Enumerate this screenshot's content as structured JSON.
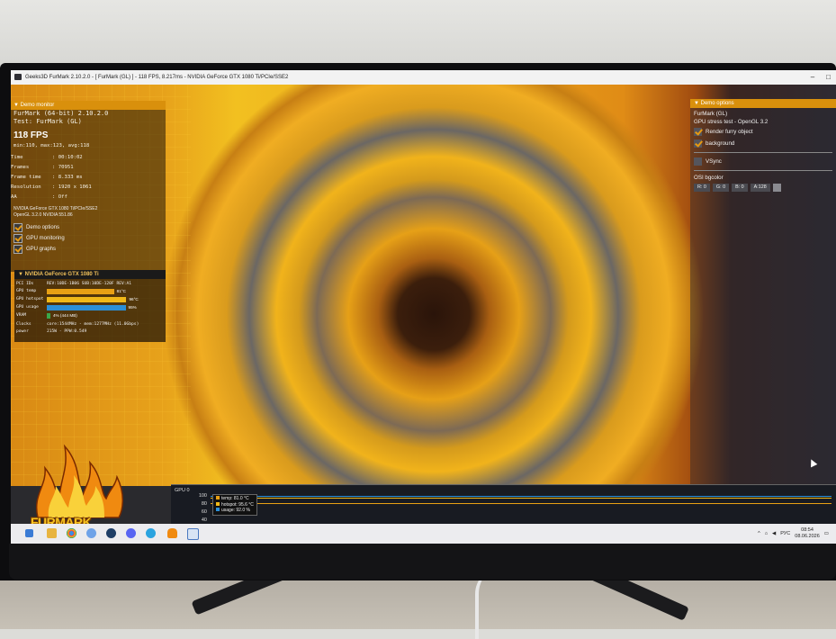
{
  "window": {
    "title": "Geeks3D FurMark 2.10.2.0 - [ FurMark (GL) ] - 118 FPS, 8.217ms - NVIDIA GeForce GTX 1080 Ti/PCIe/SSE2",
    "minimize": "–",
    "maximize": "□"
  },
  "demo_monitor": {
    "header": "Demo monitor",
    "app_line": "FurMark (64-bit) 2.10.2.0",
    "test_line": "Test: FurMark (GL)",
    "fps": "118 FPS",
    "fps_stats": "min:110, max:123, avg:118",
    "stats": [
      {
        "label": "Time",
        "value": ": 00:10:02"
      },
      {
        "label": "Frames",
        "value": ": 70951"
      },
      {
        "label": "Frame time",
        "value": ": 8.333 ms"
      },
      {
        "label": "Resolution",
        "value": ": 1920 x 1061"
      },
      {
        "label": "AA",
        "value": ": Off"
      }
    ],
    "gpu_line": "NVIDIA GeForce GTX 1080 Ti/PCIe/SSE2",
    "gl_line": "OpenGL 3.2.0 NVIDIA 551.86",
    "checkboxes": [
      {
        "label": "Demo options",
        "checked": true
      },
      {
        "label": "GPU monitoring",
        "checked": true
      },
      {
        "label": "GPU graphs",
        "checked": true
      }
    ]
  },
  "gpu_panel": {
    "header": "NVIDIA GeForce GTX 1080 Ti",
    "pci_label": "PCI IDs",
    "pci_value": "REV:10DE-1B06 SUB:10DE-120F REV:A1",
    "rows": [
      {
        "label": "GPU temp",
        "value": "81°C",
        "level": 0.81,
        "color": "#e8a014"
      },
      {
        "label": "GPU hotspot",
        "value": "96°C",
        "level": 0.96,
        "color": "#f0b818"
      },
      {
        "label": "GPU usage",
        "value": "95%",
        "level": 0.95,
        "color": "#2a8fd8"
      },
      {
        "label": "VRAM",
        "value": "4% (444 MB)",
        "level": 0.04,
        "color": "#3aa84a"
      }
    ],
    "clocks_label": "Clocks",
    "clocks_value": "core:1544MHz - mem:1277MHz (11.0Gbps)",
    "power_label": "power",
    "power_value": "215W - PPW:0.549"
  },
  "logo_text": "FURMARK",
  "demo_options": {
    "header": "Demo options",
    "name": "FurMark (GL)",
    "desc": "GPU stress test - OpenGL 3.2",
    "checkboxes": [
      {
        "label": "Render furry object",
        "checked": true
      },
      {
        "label": "background",
        "checked": true
      }
    ],
    "vsync": {
      "label": "VSync",
      "checked": false
    },
    "osi_label": "OSI bgcolor",
    "color_fields": [
      "R: 0",
      "G: 0",
      "B: 0",
      "A:128"
    ]
  },
  "graph": {
    "label": "GPU 0",
    "ticks": [
      "100",
      "80",
      "60",
      "40"
    ],
    "legend": [
      {
        "label": "temp: 81.0 °C",
        "color": "#e8a014"
      },
      {
        "label": "hotspot: 95.6 °C",
        "color": "#f0b818"
      },
      {
        "label": "usage: 92.0 %",
        "color": "#2a8fd8"
      }
    ]
  },
  "taskbar": {
    "icons": [
      "windows-icon",
      "file-explorer-icon",
      "chrome-icon",
      "browser-icon",
      "steam-icon",
      "discord-icon",
      "telegram-icon",
      "furmark-icon",
      "app-icon"
    ],
    "tray_lang": "РУС",
    "time": "08:54",
    "date": "08.06.2026"
  }
}
